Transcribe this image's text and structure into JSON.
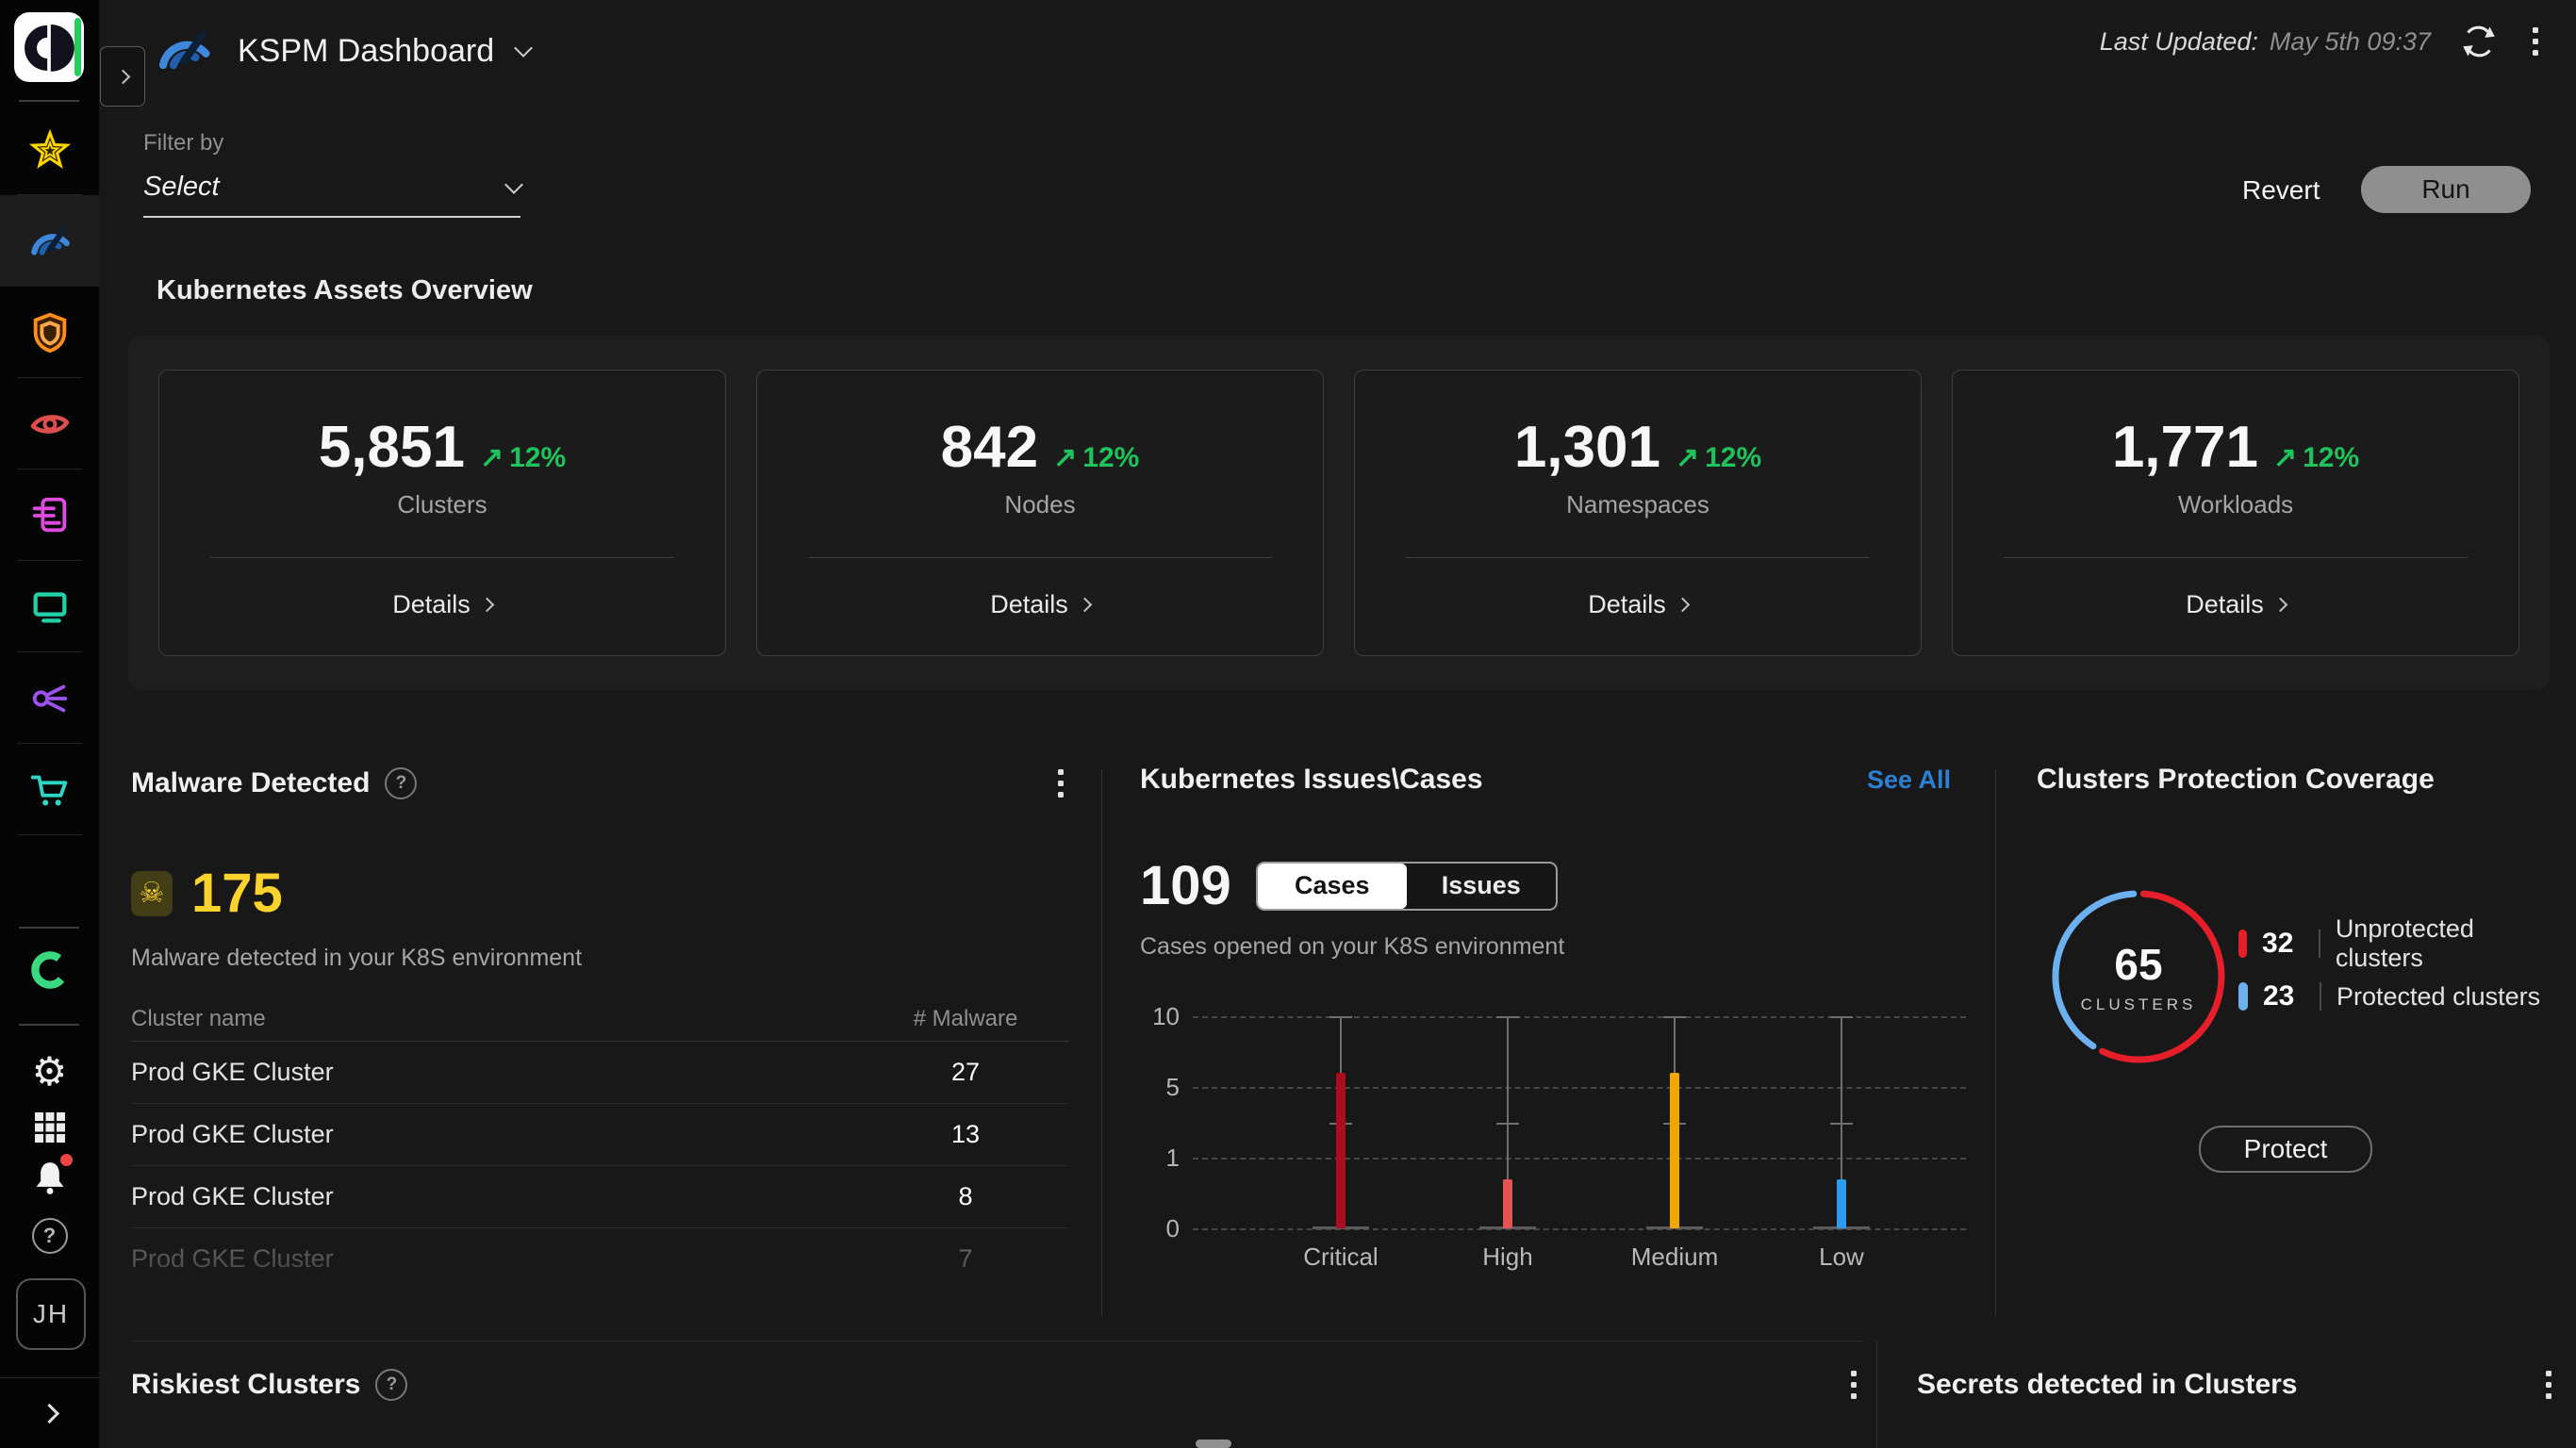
{
  "header": {
    "title": "KSPM Dashboard",
    "last_updated_label": "Last Updated:",
    "last_updated_value": "May 5th 09:37"
  },
  "filter": {
    "label": "Filter by",
    "value": "Select"
  },
  "actions": {
    "revert": "Revert",
    "run": "Run"
  },
  "icons": {
    "trend_up": "↗",
    "skull": "☠",
    "gear": "⚙",
    "question": "?"
  },
  "sidebar": {
    "avatar_initials": "JH",
    "nav_icons": [
      "star-icon",
      "gauge-icon",
      "shield-icon",
      "eye-icon",
      "document-icon",
      "monitor-icon",
      "share-icon",
      "cart-icon"
    ],
    "selected_icon": "gauge-icon",
    "bottom_icons": [
      "ring-icon",
      "settings-gear-icon",
      "apps-grid-icon",
      "notifications-bell-icon",
      "help-icon"
    ],
    "has_notification_dot": true
  },
  "assets": {
    "title": "Kubernetes Assets Overview",
    "details_label": "Details",
    "cards": [
      {
        "value": "5,851",
        "delta": "12%",
        "label": "Clusters"
      },
      {
        "value": "842",
        "delta": "12%",
        "label": "Nodes"
      },
      {
        "value": "1,301",
        "delta": "12%",
        "label": "Namespaces"
      },
      {
        "value": "1,771",
        "delta": "12%",
        "label": "Workloads"
      }
    ]
  },
  "malware": {
    "title": "Malware Detected",
    "count": "175",
    "subtitle": "Malware detected in your K8S environment",
    "columns": [
      "Cluster name",
      "# Malware"
    ],
    "rows": [
      {
        "name": "Prod GKE Cluster",
        "count": "27"
      },
      {
        "name": "Prod GKE Cluster",
        "count": "13"
      },
      {
        "name": "Prod GKE Cluster",
        "count": "8"
      },
      {
        "name": "Prod GKE Cluster",
        "count": "7"
      }
    ]
  },
  "issues": {
    "title": "Kubernetes Issues\\Cases",
    "see_all": "See All",
    "count": "109",
    "toggles": [
      "Cases",
      "Issues"
    ],
    "active_toggle": "Cases",
    "subtitle": "Cases opened on your K8S environment"
  },
  "protection": {
    "title": "Clusters Protection Coverage",
    "total": "65",
    "total_label": "CLUSTERS",
    "legend": [
      {
        "value": "32",
        "label": "Unprotected clusters",
        "color": "#e61e2a"
      },
      {
        "value": "23",
        "label": "Protected clusters",
        "color": "#6cb0f0"
      }
    ],
    "button": "Protect"
  },
  "bottom": {
    "riskiest_title": "Riskiest Clusters",
    "secrets_title": "Secrets detected in Clusters"
  },
  "chart_data": [
    {
      "type": "bar",
      "title": "Cases opened on your K8S environment",
      "categories": [
        "Critical",
        "High",
        "Medium",
        "Low"
      ],
      "values": [
        6,
        0.7,
        6,
        0.7
      ],
      "colors": [
        "#ab0c1e",
        "#e25352",
        "#f6a500",
        "#2d9cf0"
      ],
      "yticks": [
        0,
        1,
        5,
        10
      ],
      "whisker_max": 10,
      "whisker_mid": 3,
      "grid": "dashed-horizontal",
      "ylim": [
        0,
        10
      ]
    },
    {
      "type": "pie",
      "title": "Clusters Protection Coverage",
      "slices": [
        {
          "label": "Unprotected clusters",
          "value": 32,
          "color": "#e61e2a"
        },
        {
          "label": "Protected clusters",
          "value": 23,
          "color": "#6cb0f0"
        }
      ],
      "center_value": 65,
      "center_label": "CLUSTERS"
    }
  ]
}
